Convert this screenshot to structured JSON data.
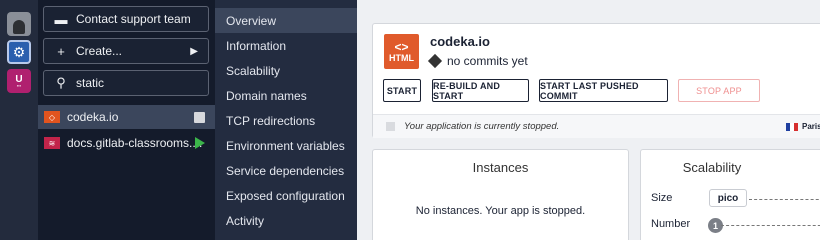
{
  "org_rail": {
    "orgs": [
      {
        "name": "personal",
        "icon": "user-avatar-icon"
      },
      {
        "name": "org",
        "icon": "gear-org-icon"
      },
      {
        "name": "university",
        "icon": "university-logo-icon",
        "label": "U"
      }
    ]
  },
  "sidebar": {
    "support_label": "Contact support team",
    "create_label": "Create...",
    "search_value": "static",
    "apps": [
      {
        "name": "codeka.io",
        "status_icon": "checkbox-icon"
      },
      {
        "name": "docs.gitlab-classrooms....",
        "status_icon": "running-play-icon"
      }
    ]
  },
  "submenu": {
    "items": [
      "Overview",
      "Information",
      "Scalability",
      "Domain names",
      "TCP redirections",
      "Environment variables",
      "Service dependencies",
      "Exposed configuration",
      "Activity"
    ],
    "active": "Overview"
  },
  "overview": {
    "logo_text": "HTML",
    "logo_symbol": "<>",
    "app_name": "codeka.io",
    "commit_text": "no commits yet",
    "buttons": {
      "start": "START",
      "rebuild": "RE-BUILD AND START",
      "last_pushed": "START LAST PUSHED COMMIT",
      "stop": "STOP APP"
    },
    "status_message": "Your application is currently stopped.",
    "zone": "Paris"
  },
  "instances": {
    "title": "Instances",
    "empty_message": "No instances. Your app is stopped."
  },
  "scalability": {
    "title": "Scalability",
    "size_label": "Size",
    "size_value": "pico",
    "number_label": "Number",
    "number_value": "1"
  },
  "colors": {
    "rail_bg": "#232b3d",
    "sidebar_bg": "#141b2b",
    "submenu_bg": "#232c40",
    "active_bg": "#3b465c",
    "html_logo": "#e05a2b",
    "stop_text": "#ef8f8f",
    "play_green": "#3bb54a"
  }
}
